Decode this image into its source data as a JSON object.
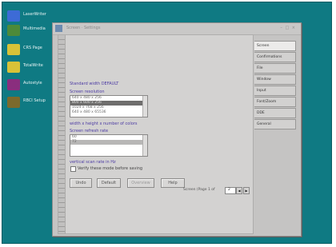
{
  "desktop": {
    "icons": [
      {
        "label": "LaserWriter",
        "color": "#3d6bd6"
      },
      {
        "label": "Multimedia",
        "color": "#4d8a3a"
      },
      {
        "label": "CRS Page",
        "color": "#d8c238"
      },
      {
        "label": "TotalWrite",
        "color": "#d8c238"
      },
      {
        "label": "Autostyle",
        "color": "#8a2e7e"
      },
      {
        "label": "RBCI Setup",
        "color": "#7c6a2c"
      }
    ]
  },
  "window": {
    "title": "Screen · Settings",
    "controls": "– □ ×"
  },
  "panel": {
    "heading": "Standard width   DEFAULT",
    "group1_label": "Screen resolution",
    "resolutions": [
      "640 x 480 x 256",
      "800 x 600 x 256",
      "1024 x 768 x 256",
      "640 x 480 x 65536"
    ],
    "group2_label": "width x height x number of colors",
    "group3_label": "Screen refresh rate",
    "refresh_rates": [
      "60",
      "72",
      "",
      ""
    ],
    "note": "vertical scan rate in Hz",
    "checkbox_label": "Verify these mode before saving"
  },
  "buttons": {
    "undo": "Undo",
    "default": "Default",
    "overview": "Overview",
    "help": "Help"
  },
  "status": {
    "text": "Screen (Page 1 of",
    "page_number": "2",
    "prev_arrow": "◀",
    "next_arrow": "▶"
  },
  "tabs": [
    "Screen",
    "Confirmations",
    "File",
    "Window",
    "Input",
    "Font/Zoom",
    "DDE",
    "General"
  ],
  "colors": {
    "desktop": "#0f7a83",
    "window_bg": "#c5c4c3",
    "accent_text": "#4b3aa3"
  }
}
